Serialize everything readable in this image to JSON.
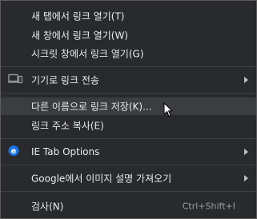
{
  "menu": {
    "items": [
      {
        "label": "새 탭에서 링크 열기(T)"
      },
      {
        "label": "새 창에서 링크 열기(W)"
      },
      {
        "label": "시크릿 창에서 링크 열기(G)"
      },
      {
        "label": "기기로 링크 전송",
        "icon": "devices-icon",
        "submenu": true
      },
      {
        "label": "다른 이름으로 링크 저장(K)...",
        "hovered": true
      },
      {
        "label": "링크 주소 복사(E)"
      },
      {
        "label": "IE Tab Options",
        "icon": "ie-tab-icon",
        "submenu": true
      },
      {
        "label": "Google에서 이미지 설명 가져오기",
        "submenu": true
      },
      {
        "label": "검사(N)",
        "shortcut": "Ctrl+Shift+I"
      }
    ]
  },
  "colors": {
    "background": "#292a2d",
    "text": "#e8eaed",
    "hover": "#3c3d41",
    "separator": "#3f4043",
    "ie_icon": "#1a73e8"
  }
}
